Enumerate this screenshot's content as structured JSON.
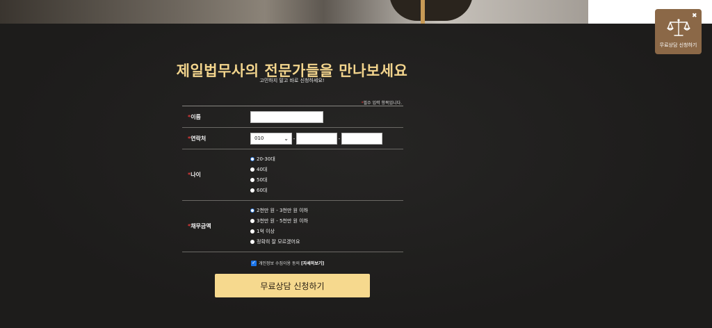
{
  "header": {},
  "main": {
    "title": "제일법무사의 전문가들을 만나보세요",
    "subtitle": "고민하지 말고 바로 신청하세요!",
    "required_note": "필수 입력 항목입니다.",
    "required_mark": "*"
  },
  "form": {
    "name": {
      "label": "이름",
      "value": ""
    },
    "phone": {
      "label": "연락처",
      "prefix_selected": "010",
      "middle": "",
      "last": "",
      "separator": "-"
    },
    "age": {
      "label": "나이",
      "options": [
        "20-30대",
        "40대",
        "50대",
        "60대"
      ],
      "selected": "20-30대"
    },
    "debt": {
      "label": "채무금액",
      "options": [
        "2천만 원 - 3천만 원 이하",
        "3천만 원 - 5천만 원 이하",
        "1억 이상",
        "정확히 잘 모르겠어요"
      ],
      "selected": "2천만 원 - 3천만 원 이하"
    },
    "consent": {
      "label": "개인정보 수집이용 동의",
      "detail_link": "[자세히보기]",
      "checked": true
    },
    "submit_label": "무료상담 신청하기"
  },
  "floating_button": {
    "label": "무료상담 신청하기",
    "icon": "scales-of-justice-icon",
    "close": "✖",
    "bg_color": "#8b6847"
  },
  "colors": {
    "accent": "#f3d58d",
    "button": "#f6d98e",
    "required": "#e23b3b",
    "background": "#1f1e1d"
  }
}
